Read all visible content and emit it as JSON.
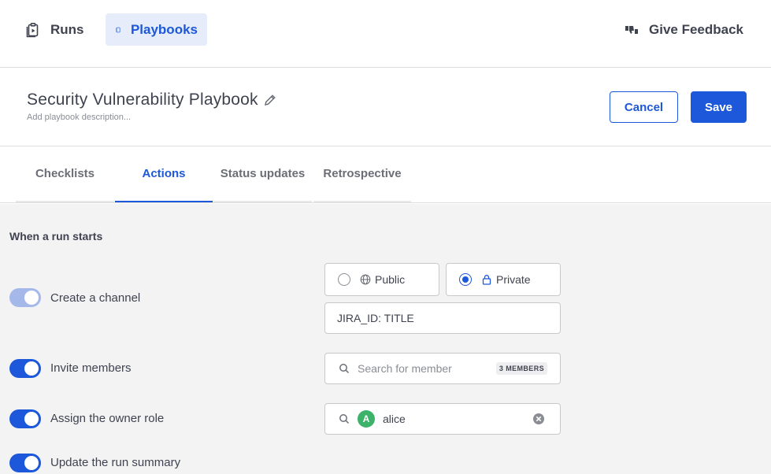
{
  "nav": {
    "runs_label": "Runs",
    "playbooks_label": "Playbooks",
    "feedback_label": "Give Feedback"
  },
  "header": {
    "title": "Security Vulnerability Playbook",
    "description_placeholder": "Add playbook description...",
    "cancel_label": "Cancel",
    "save_label": "Save"
  },
  "tabs": [
    {
      "label": "Checklists",
      "active": false
    },
    {
      "label": "Actions",
      "active": true
    },
    {
      "label": "Status updates",
      "active": false
    },
    {
      "label": "Retrospective",
      "active": false
    }
  ],
  "actions": {
    "section_title": "When a run starts",
    "rows": [
      {
        "label": "Create a channel",
        "enabled": true,
        "toggle_disabled": true
      },
      {
        "label": "Invite members",
        "enabled": true
      },
      {
        "label": "Assign the owner role",
        "enabled": true
      },
      {
        "label": "Update the run summary",
        "enabled": true
      }
    ],
    "channel": {
      "public_label": "Public",
      "private_label": "Private",
      "selected": "Private",
      "name_value": "JIRA_ID: TITLE"
    },
    "members": {
      "search_placeholder": "Search for member",
      "count_badge": "3 MEMBERS"
    },
    "owner": {
      "avatar_initial": "A",
      "value": "alice"
    }
  },
  "colors": {
    "accent": "#1c58d9",
    "active_nav_bg": "#e6ecf9",
    "avatar_bg": "#3db36a",
    "content_bg": "#f3f3f4"
  }
}
